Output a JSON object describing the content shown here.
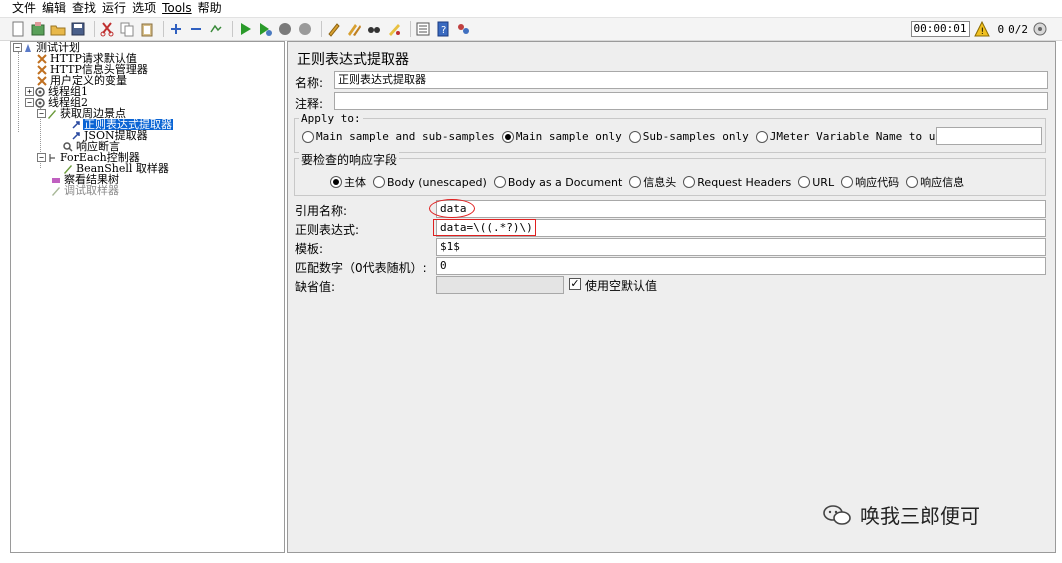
{
  "menu": [
    "文件",
    "编辑",
    "查找",
    "运行",
    "选项",
    "Tools",
    "帮助"
  ],
  "toolbar": {
    "icons": [
      "new-icon",
      "templates-icon",
      "open-icon",
      "save-icon",
      "cut-icon",
      "copy-icon",
      "paste-icon",
      "expand-icon",
      "collapse-icon",
      "toggle-icon",
      "start-icon",
      "start-no-pause-icon",
      "stop-icon",
      "shutdown-icon",
      "clear-icon",
      "clear-all-icon",
      "search-icon",
      "reset-search-icon",
      "function-helper-icon",
      "help-icon",
      "remote-icon"
    ],
    "timer": "00:00:01",
    "warn_count": "0",
    "threads": "0/2"
  },
  "tree": {
    "items": [
      {
        "label": "测试计划",
        "icon": "test-plan-icon"
      },
      {
        "label": "HTTP请求默认值",
        "icon": "wrench-icon"
      },
      {
        "label": "HTTP信息头管理器",
        "icon": "wrench-icon"
      },
      {
        "label": "用户定义的变量",
        "icon": "wrench-icon"
      },
      {
        "label": "线程组1",
        "icon": "thread-group-icon"
      },
      {
        "label": "线程组2",
        "icon": "thread-group-icon"
      },
      {
        "label": "获取周边景点",
        "icon": "sampler-icon"
      },
      {
        "label": "正则表达式提取器",
        "icon": "extractor-icon"
      },
      {
        "label": "JSON提取器",
        "icon": "extractor-icon"
      },
      {
        "label": "响应断言",
        "icon": "assertion-icon"
      },
      {
        "label": "ForEach控制器",
        "icon": "controller-icon"
      },
      {
        "label": "BeanShell 取样器",
        "icon": "sampler-icon"
      },
      {
        "label": "察看结果树",
        "icon": "listener-icon"
      },
      {
        "label": "调试取样器",
        "icon": "sampler-icon"
      }
    ]
  },
  "panel": {
    "title": "正则表达式提取器",
    "name_label": "名称:",
    "name_value": "正则表达式提取器",
    "comment_label": "注释:",
    "comment_value": "",
    "apply_to": {
      "title": "Apply to:",
      "options": [
        "Main sample and sub-samples",
        "Main sample only",
        "Sub-samples only",
        "JMeter Variable Name to use"
      ],
      "selected": 1,
      "variable_value": ""
    },
    "field_to_check": {
      "title": "要检查的响应字段",
      "options": [
        "主体",
        "Body (unescaped)",
        "Body as a Document",
        "信息头",
        "Request Headers",
        "URL",
        "响应代码",
        "响应信息"
      ],
      "selected": 0
    },
    "ref_name_label": "引用名称:",
    "ref_name_value": "data",
    "regex_label": "正则表达式:",
    "regex_value": "data=\\((.*?)\\)",
    "template_label": "模板:",
    "template_value": "$1$",
    "match_no_label": "匹配数字（0代表随机）:",
    "match_no_value": "0",
    "default_label": "缺省值:",
    "default_value": "",
    "use_empty_label": "使用空默认值",
    "use_empty_checked": true
  },
  "watermark": "唤我三郎便可",
  "colors": {
    "selection": "#0a64d4",
    "annotation": "#e02020",
    "panel_bg": "#eeeeee"
  }
}
